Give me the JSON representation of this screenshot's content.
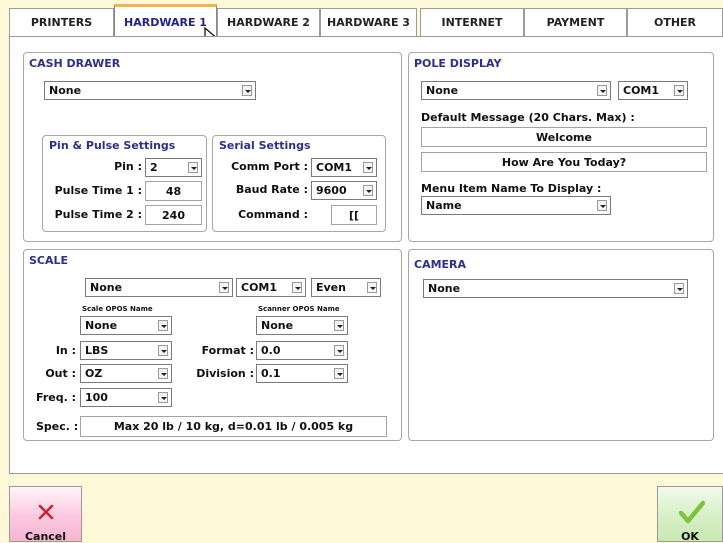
{
  "tabs": [
    "PRINTERS",
    "HARDWARE 1",
    "HARDWARE 2",
    "HARDWARE 3",
    "INTERNET",
    "PAYMENT",
    "OTHER"
  ],
  "active_tab": "HARDWARE 1",
  "cash_drawer": {
    "title": "CASH DRAWER",
    "device": "None",
    "pin_pulse": {
      "title": "Pin & Pulse Settings",
      "pin_label": "Pin :",
      "pin_value": "2",
      "pulse1_label": "Pulse Time 1 :",
      "pulse1_value": "48",
      "pulse2_label": "Pulse Time 2 :",
      "pulse2_value": "240"
    },
    "serial": {
      "title": "Serial Settings",
      "comm_label": "Comm Port :",
      "comm_value": "COM1",
      "baud_label": "Baud Rate :",
      "baud_value": "9600",
      "command_label": "Command :",
      "command_value": "[["
    }
  },
  "pole_display": {
    "title": "POLE DISPLAY",
    "device": "None",
    "port": "COM1",
    "default_msg_label": "Default Message (20 Chars. Max) :",
    "line1": "Welcome",
    "line2": "How Are You Today?",
    "menu_item_label": "Menu Item Name To Display :",
    "menu_item_value": "Name"
  },
  "scale": {
    "title": "SCALE",
    "device": "None",
    "port": "COM1",
    "parity": "Even",
    "scale_opos_label": "Scale OPOS Name",
    "scale_opos_value": "None",
    "scanner_opos_label": "Scanner OPOS Name",
    "scanner_opos_value": "None",
    "in_label": "In :",
    "in_value": "LBS",
    "out_label": "Out :",
    "out_value": "OZ",
    "freq_label": "Freq. :",
    "freq_value": "100",
    "format_label": "Format :",
    "format_value": "0.0",
    "division_label": "Division :",
    "division_value": "0.1",
    "spec_label": "Spec. :",
    "spec_value": "Max 20 lb / 10 kg, d=0.01 lb / 0.005 kg"
  },
  "camera": {
    "title": "CAMERA",
    "device": "None"
  },
  "buttons": {
    "cancel": "Cancel",
    "ok": "OK"
  },
  "colors": {
    "background": "#fdf9d8",
    "title_blue": "#2d2f8a",
    "tab_accent": "#f0b44a",
    "cancel_icon": "#c8243a",
    "ok_icon": "#7cc43a"
  }
}
